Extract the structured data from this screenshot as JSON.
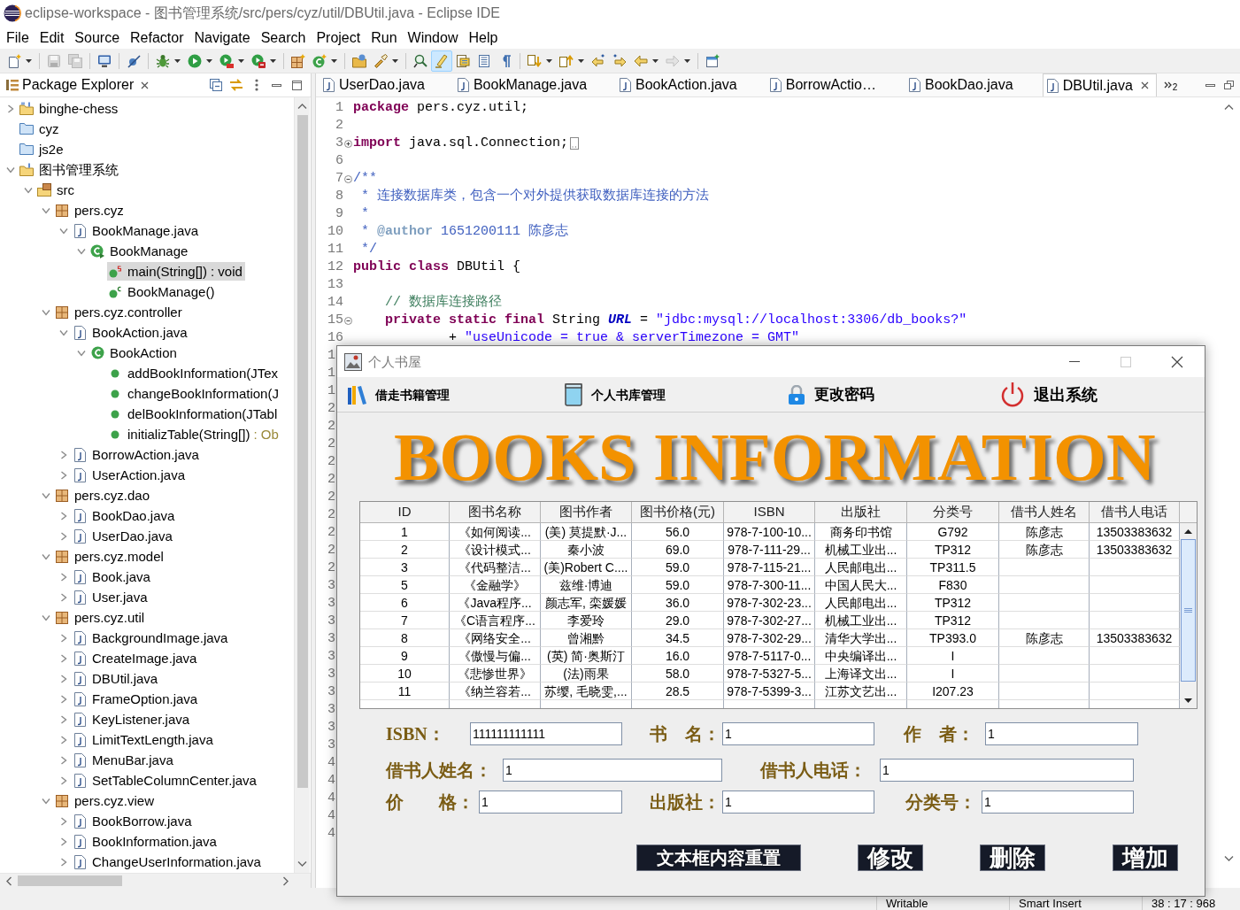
{
  "window": {
    "title": "eclipse-workspace - 图书管理系统/src/pers/cyz/util/DBUtil.java - Eclipse IDE"
  },
  "menu": [
    "File",
    "Edit",
    "Source",
    "Refactor",
    "Navigate",
    "Search",
    "Project",
    "Run",
    "Window",
    "Help"
  ],
  "toolbar": [
    {
      "kind": "new",
      "caret": true,
      "disabled": false,
      "pressed": false
    },
    {
      "kind": "save",
      "caret": false,
      "disabled": true,
      "pressed": false
    },
    {
      "kind": "save-all",
      "caret": false,
      "disabled": true,
      "pressed": false
    },
    {
      "kind": "terminal",
      "caret": false,
      "disabled": false,
      "pressed": false
    },
    {
      "kind": "skip-breakpoints",
      "caret": false,
      "disabled": false,
      "pressed": false
    },
    {
      "kind": "debug",
      "caret": true,
      "disabled": false,
      "pressed": false
    },
    {
      "kind": "run",
      "caret": true,
      "disabled": false,
      "pressed": false
    },
    {
      "kind": "coverage",
      "caret": true,
      "disabled": false,
      "pressed": false
    },
    {
      "kind": "external-tools",
      "caret": true,
      "disabled": false,
      "pressed": false
    },
    {
      "kind": "new-package",
      "caret": false,
      "disabled": false,
      "pressed": false
    },
    {
      "kind": "new-class",
      "caret": true,
      "disabled": false,
      "pressed": false
    },
    {
      "kind": "open-type",
      "caret": false,
      "disabled": false,
      "pressed": false
    },
    {
      "kind": "search",
      "caret": true,
      "disabled": false,
      "pressed": false
    },
    {
      "kind": "open-task",
      "caret": false,
      "disabled": false,
      "pressed": false
    },
    {
      "kind": "mark-occurrences",
      "caret": false,
      "disabled": false,
      "pressed": true
    },
    {
      "kind": "block-selection",
      "caret": false,
      "disabled": false,
      "pressed": false
    },
    {
      "kind": "word-wrap",
      "caret": false,
      "disabled": false,
      "pressed": false
    },
    {
      "kind": "show-whitespace",
      "caret": false,
      "disabled": false,
      "pressed": false
    },
    {
      "kind": "next-annotation",
      "caret": true,
      "disabled": false,
      "pressed": false
    },
    {
      "kind": "previous-annotation",
      "caret": true,
      "disabled": false,
      "pressed": false
    },
    {
      "kind": "last-edit",
      "caret": false,
      "disabled": false,
      "pressed": false
    },
    {
      "kind": "next-edit",
      "caret": false,
      "disabled": false,
      "pressed": false
    },
    {
      "kind": "back",
      "caret": true,
      "disabled": false,
      "pressed": false
    },
    {
      "kind": "forward",
      "caret": true,
      "disabled": true,
      "pressed": false
    },
    {
      "kind": "new-window",
      "caret": false,
      "disabled": false,
      "pressed": false
    }
  ],
  "package_explorer": {
    "title": "Package Explorer",
    "tree": [
      {
        "label": "binghe-chess",
        "kind": "maven-project",
        "expanded": false,
        "selected": false
      },
      {
        "label": "cyz",
        "kind": "closed-project",
        "selected": false
      },
      {
        "label": "js2e",
        "kind": "closed-project",
        "selected": false
      },
      {
        "label": "图书管理系统",
        "kind": "project",
        "expanded": true,
        "selected": false,
        "children": [
          {
            "label": "src",
            "kind": "source-folder",
            "expanded": true,
            "selected": false,
            "children": [
              {
                "label": "pers.cyz",
                "kind": "package",
                "expanded": true,
                "selected": false,
                "children": [
                  {
                    "label": "BookManage.java",
                    "kind": "java-file",
                    "expanded": true,
                    "selected": false,
                    "children": [
                      {
                        "label": "BookManage",
                        "kind": "main-class",
                        "expanded": true,
                        "selected": false,
                        "children": [
                          {
                            "label": "main(String[])",
                            "return_type": ": void",
                            "kind": "static-method",
                            "selected": true
                          },
                          {
                            "label": "BookManage()",
                            "kind": "constructor",
                            "selected": false
                          }
                        ]
                      }
                    ]
                  }
                ]
              },
              {
                "label": "pers.cyz.controller",
                "kind": "package",
                "expanded": true,
                "selected": false,
                "children": [
                  {
                    "label": "BookAction.java",
                    "kind": "java-file",
                    "expanded": true,
                    "selected": false,
                    "children": [
                      {
                        "label": "BookAction",
                        "kind": "class",
                        "expanded": true,
                        "selected": false,
                        "children": [
                          {
                            "label": "addBookInformation(JTex",
                            "kind": "method",
                            "selected": false
                          },
                          {
                            "label": "changeBookInformation(J",
                            "kind": "method",
                            "selected": false
                          },
                          {
                            "label": "delBookInformation(JTabl",
                            "kind": "method",
                            "selected": false
                          },
                          {
                            "label": "initializTable(String[])",
                            "return_type": ": Ob",
                            "kind": "method",
                            "selected": false
                          }
                        ]
                      }
                    ]
                  },
                  {
                    "label": "BorrowAction.java",
                    "kind": "java-file",
                    "expanded": false,
                    "selected": false
                  },
                  {
                    "label": "UserAction.java",
                    "kind": "java-file",
                    "expanded": false,
                    "selected": false
                  }
                ]
              },
              {
                "label": "pers.cyz.dao",
                "kind": "package",
                "expanded": true,
                "selected": false,
                "children": [
                  {
                    "label": "BookDao.java",
                    "kind": "java-file",
                    "expanded": false,
                    "selected": false
                  },
                  {
                    "label": "UserDao.java",
                    "kind": "java-file",
                    "expanded": false,
                    "selected": false
                  }
                ]
              },
              {
                "label": "pers.cyz.model",
                "kind": "package",
                "expanded": true,
                "selected": false,
                "children": [
                  {
                    "label": "Book.java",
                    "kind": "java-file",
                    "expanded": false,
                    "selected": false
                  },
                  {
                    "label": "User.java",
                    "kind": "java-file",
                    "expanded": false,
                    "selected": false
                  }
                ]
              },
              {
                "label": "pers.cyz.util",
                "kind": "package",
                "expanded": true,
                "selected": false,
                "children": [
                  {
                    "label": "BackgroundImage.java",
                    "kind": "java-file",
                    "expanded": false,
                    "selected": false
                  },
                  {
                    "label": "CreateImage.java",
                    "kind": "java-file",
                    "expanded": false,
                    "selected": false
                  },
                  {
                    "label": "DBUtil.java",
                    "kind": "java-file",
                    "expanded": false,
                    "selected": false
                  },
                  {
                    "label": "FrameOption.java",
                    "kind": "java-file",
                    "expanded": false,
                    "selected": false
                  },
                  {
                    "label": "KeyListener.java",
                    "kind": "java-file",
                    "expanded": false,
                    "selected": false
                  },
                  {
                    "label": "LimitTextLength.java",
                    "kind": "java-file",
                    "expanded": false,
                    "selected": false
                  },
                  {
                    "label": "MenuBar.java",
                    "kind": "java-file",
                    "expanded": false,
                    "selected": false
                  },
                  {
                    "label": "SetTableColumnCenter.java",
                    "kind": "java-file",
                    "expanded": false,
                    "selected": false
                  }
                ]
              },
              {
                "label": "pers.cyz.view",
                "kind": "package",
                "expanded": true,
                "selected": false,
                "children": [
                  {
                    "label": "BookBorrow.java",
                    "kind": "java-file",
                    "expanded": false,
                    "selected": false
                  },
                  {
                    "label": "BookInformation.java",
                    "kind": "java-file",
                    "expanded": false,
                    "selected": false
                  },
                  {
                    "label": "ChangeUserInformation.java",
                    "kind": "java-file",
                    "expanded": false,
                    "selected": false
                  }
                ]
              }
            ]
          }
        ]
      }
    ]
  },
  "editor": {
    "tabs": [
      {
        "label": "UserDao.java",
        "selected": false
      },
      {
        "label": "BookManage.java",
        "selected": false
      },
      {
        "label": "BookAction.java",
        "selected": false
      },
      {
        "label": "BorrowActio…",
        "selected": false
      },
      {
        "label": "BookDao.java",
        "selected": false
      },
      {
        "label": "DBUtil.java",
        "selected": true
      }
    ],
    "overflow_count": "2",
    "lines": [
      {
        "number": "1",
        "tokens": [
          {
            "text": "package ",
            "kind": "keyword"
          },
          {
            "text": "pers.cyz.util;",
            "kind": "plain"
          }
        ]
      },
      {
        "number": "2"
      },
      {
        "number": "3",
        "collapsed": true,
        "tokens": [
          {
            "text": "import ",
            "kind": "keyword"
          },
          {
            "text": "java.sql.Connection;",
            "kind": "plain"
          }
        ]
      },
      {
        "number": "6"
      },
      {
        "number": "7",
        "collapsed": false,
        "tokens": [
          {
            "text": "/**",
            "kind": "javadoc"
          }
        ]
      },
      {
        "number": "8",
        "tokens": [
          {
            "text": " * 连接数据库类，包含一个对外提供获取数据库连接的方法",
            "kind": "javadoc"
          }
        ]
      },
      {
        "number": "9",
        "tokens": [
          {
            "text": " *",
            "kind": "javadoc"
          }
        ]
      },
      {
        "number": "10",
        "tokens": [
          {
            "text": " * ",
            "kind": "javadoc"
          },
          {
            "text": "@author",
            "kind": "javadoc-tag"
          },
          {
            "text": " 1651200111 陈彦志",
            "kind": "javadoc"
          }
        ]
      },
      {
        "number": "11",
        "tokens": [
          {
            "text": " */",
            "kind": "javadoc"
          }
        ]
      },
      {
        "number": "12",
        "tokens": [
          {
            "text": "public class ",
            "kind": "keyword"
          },
          {
            "text": "DBUtil {",
            "kind": "plain"
          }
        ]
      },
      {
        "number": "13"
      },
      {
        "number": "14",
        "tokens": [
          {
            "text": "    // 数据库连接路径",
            "kind": "comment"
          }
        ]
      },
      {
        "number": "15",
        "collapsed": false,
        "tokens": [
          {
            "text": "    private static final ",
            "kind": "keyword"
          },
          {
            "text": "String ",
            "kind": "plain"
          },
          {
            "text": "URL",
            "kind": "field"
          },
          {
            "text": " = ",
            "kind": "plain"
          },
          {
            "text": "\"jdbc:mysql://localhost:3306/db_books?\"",
            "kind": "string"
          }
        ]
      },
      {
        "number": "16",
        "tokens": [
          {
            "text": "            + ",
            "kind": "plain"
          },
          {
            "text": "\"useUnicode = true & serverTimezone = GMT\"",
            "kind": "string"
          }
        ]
      }
    ],
    "covered_line_numbers": [
      "1",
      "1",
      "1",
      "2",
      "2",
      "2",
      "2",
      "2",
      "2",
      "2",
      "2",
      "2",
      "2",
      "3",
      "3",
      "3",
      "3",
      "3",
      "3",
      "3",
      "3",
      "3",
      "3",
      "4",
      "4",
      "4",
      "4",
      "4"
    ]
  },
  "dialog": {
    "title": "个人书屋",
    "menu": [
      "借走书籍管理",
      "个人书库管理",
      "更改密码",
      "退出系统"
    ],
    "banner": "BOOKS INFORMATION",
    "table": {
      "columns": [
        "ID",
        "图书名称",
        "图书作者",
        "图书价格(元)",
        "ISBN",
        "出版社",
        "分类号",
        "借书人姓名",
        "借书人电话"
      ],
      "rows": [
        [
          "1",
          "《如何阅读...",
          "(美) 莫提默·J...",
          "56.0",
          "978-7-100-10...",
          "商务印书馆",
          "G792",
          "陈彦志",
          "13503383632"
        ],
        [
          "2",
          "《设计模式...",
          "秦小波",
          "69.0",
          "978-7-111-29...",
          "机械工业出...",
          "TP312",
          "陈彦志",
          "13503383632"
        ],
        [
          "3",
          "《代码整洁...",
          "(美)Robert C....",
          "59.0",
          "978-7-115-21...",
          "人民邮电出...",
          "TP311.5"
        ],
        [
          "5",
          "《金融学》",
          "兹维·博迪",
          "59.0",
          "978-7-300-11...",
          "中国人民大...",
          "F830"
        ],
        [
          "6",
          "《Java程序...",
          "颜志军, 栾媛媛",
          "36.0",
          "978-7-302-23...",
          "人民邮电出...",
          "TP312"
        ],
        [
          "7",
          "《C语言程序...",
          "李爱玲",
          "29.0",
          "978-7-302-27...",
          "机械工业出...",
          "TP312"
        ],
        [
          "8",
          "《网络安全...",
          "曾湘黔",
          "34.5",
          "978-7-302-29...",
          "清华大学出...",
          "TP393.0",
          "陈彦志",
          "13503383632"
        ],
        [
          "9",
          "《傲慢与偏...",
          "(英) 简·奥斯汀",
          "16.0",
          "978-7-5117-0...",
          "中央编译出...",
          "I"
        ],
        [
          "10",
          "《悲惨世界》",
          "(法)雨果",
          "58.0",
          "978-7-5327-5...",
          "上海译文出...",
          "I"
        ],
        [
          "11",
          "《纳兰容若...",
          "苏缨, 毛晓雯,...",
          "28.5",
          "978-7-5399-3...",
          "江苏文艺出...",
          "I207.23"
        ]
      ]
    },
    "form": [
      [
        {
          "label": "ISBN：",
          "value": "111111111111"
        },
        {
          "label": "书　名：",
          "value": "1"
        },
        {
          "label": "作　者：",
          "value": "1"
        }
      ],
      [
        {
          "label": "借书人姓名：",
          "value": "1"
        },
        {
          "label": "借书人电话：",
          "value": "1"
        }
      ],
      [
        {
          "label": "价　　格：",
          "value": "1"
        },
        {
          "label": "出版社：",
          "value": "1"
        },
        {
          "label": "分类号：",
          "value": "1"
        }
      ]
    ],
    "buttons": [
      "文本框内容重置",
      "修改",
      "删除",
      "增加"
    ]
  },
  "status_bar": [
    "Writable",
    "Smart Insert",
    "38 : 17 : 968"
  ]
}
